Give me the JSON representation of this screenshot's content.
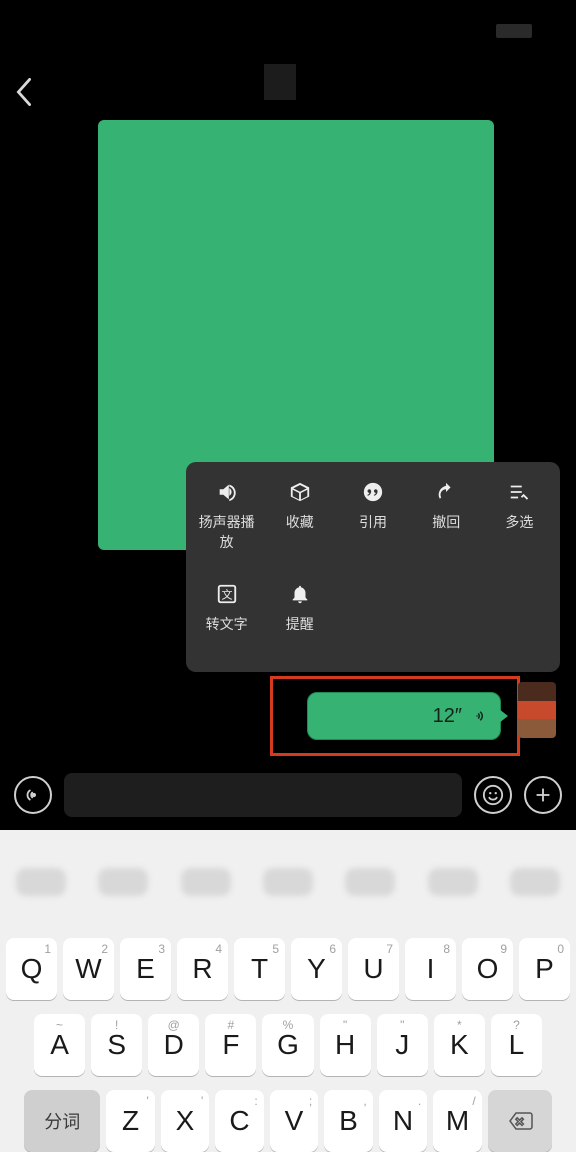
{
  "header": {
    "back_icon": "chevron-left"
  },
  "voice_bubble": {
    "duration": "12″"
  },
  "menu": {
    "speaker": "扬声器播放",
    "favorite": "收藏",
    "quote": "引用",
    "recall": "撤回",
    "multi": "多选",
    "to_text": "转文字",
    "remind": "提醒"
  },
  "keyboard": {
    "row1": [
      {
        "sup": "1",
        "main": "Q"
      },
      {
        "sup": "2",
        "main": "W"
      },
      {
        "sup": "3",
        "main": "E"
      },
      {
        "sup": "4",
        "main": "R"
      },
      {
        "sup": "5",
        "main": "T"
      },
      {
        "sup": "6",
        "main": "Y"
      },
      {
        "sup": "7",
        "main": "U"
      },
      {
        "sup": "8",
        "main": "I"
      },
      {
        "sup": "9",
        "main": "O"
      },
      {
        "sup": "0",
        "main": "P"
      }
    ],
    "row2": [
      {
        "sup": "~",
        "main": "A"
      },
      {
        "sup": "!",
        "main": "S"
      },
      {
        "sup": "@",
        "main": "D"
      },
      {
        "sup": "#",
        "main": "F"
      },
      {
        "sup": "%",
        "main": "G"
      },
      {
        "sup": "\"",
        "main": "H"
      },
      {
        "sup": "\"",
        "main": "J"
      },
      {
        "sup": "*",
        "main": "K"
      },
      {
        "sup": "?",
        "main": "L"
      }
    ],
    "row3_left": "分词",
    "row3": [
      {
        "sup": "'",
        "main": "Z"
      },
      {
        "sup": "'",
        "main": "X"
      },
      {
        "sup": ":",
        "main": "C"
      },
      {
        "sup": ";",
        "main": "V"
      },
      {
        "sup": ",",
        "main": "B"
      },
      {
        "sup": ".",
        "main": "N"
      },
      {
        "sup": "/",
        "main": "M"
      }
    ]
  }
}
